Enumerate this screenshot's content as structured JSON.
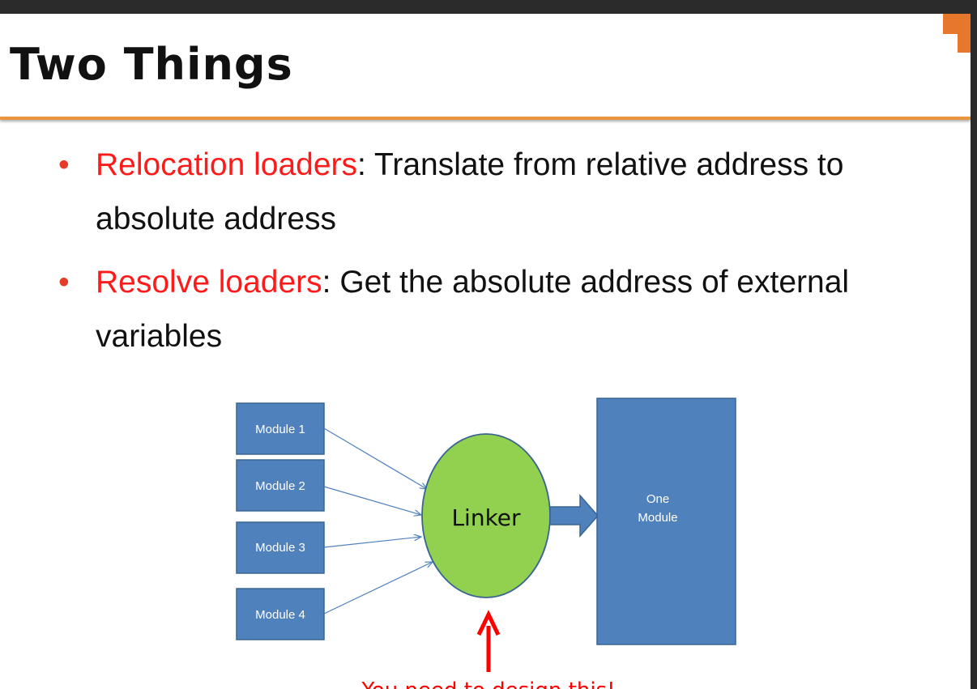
{
  "slide": {
    "title": "Two Things"
  },
  "bullets": [
    {
      "term": "Relocation loaders",
      "text": ": Translate from relative address to absolute address"
    },
    {
      "term": "Resolve loaders",
      "text": ": Get the absolute address of external variables"
    }
  ],
  "diagram": {
    "modules": [
      "Module 1",
      "Module 2",
      "Module 3",
      "Module 4"
    ],
    "linker_label": "Linker",
    "output_label_line1": "One",
    "output_label_line2": "Module",
    "annotation": "You need to design this!"
  },
  "colors": {
    "term": "#ff1a1a",
    "module_fill": "#4f81bd",
    "linker_fill": "#92d050",
    "accent": "#e8772e"
  }
}
